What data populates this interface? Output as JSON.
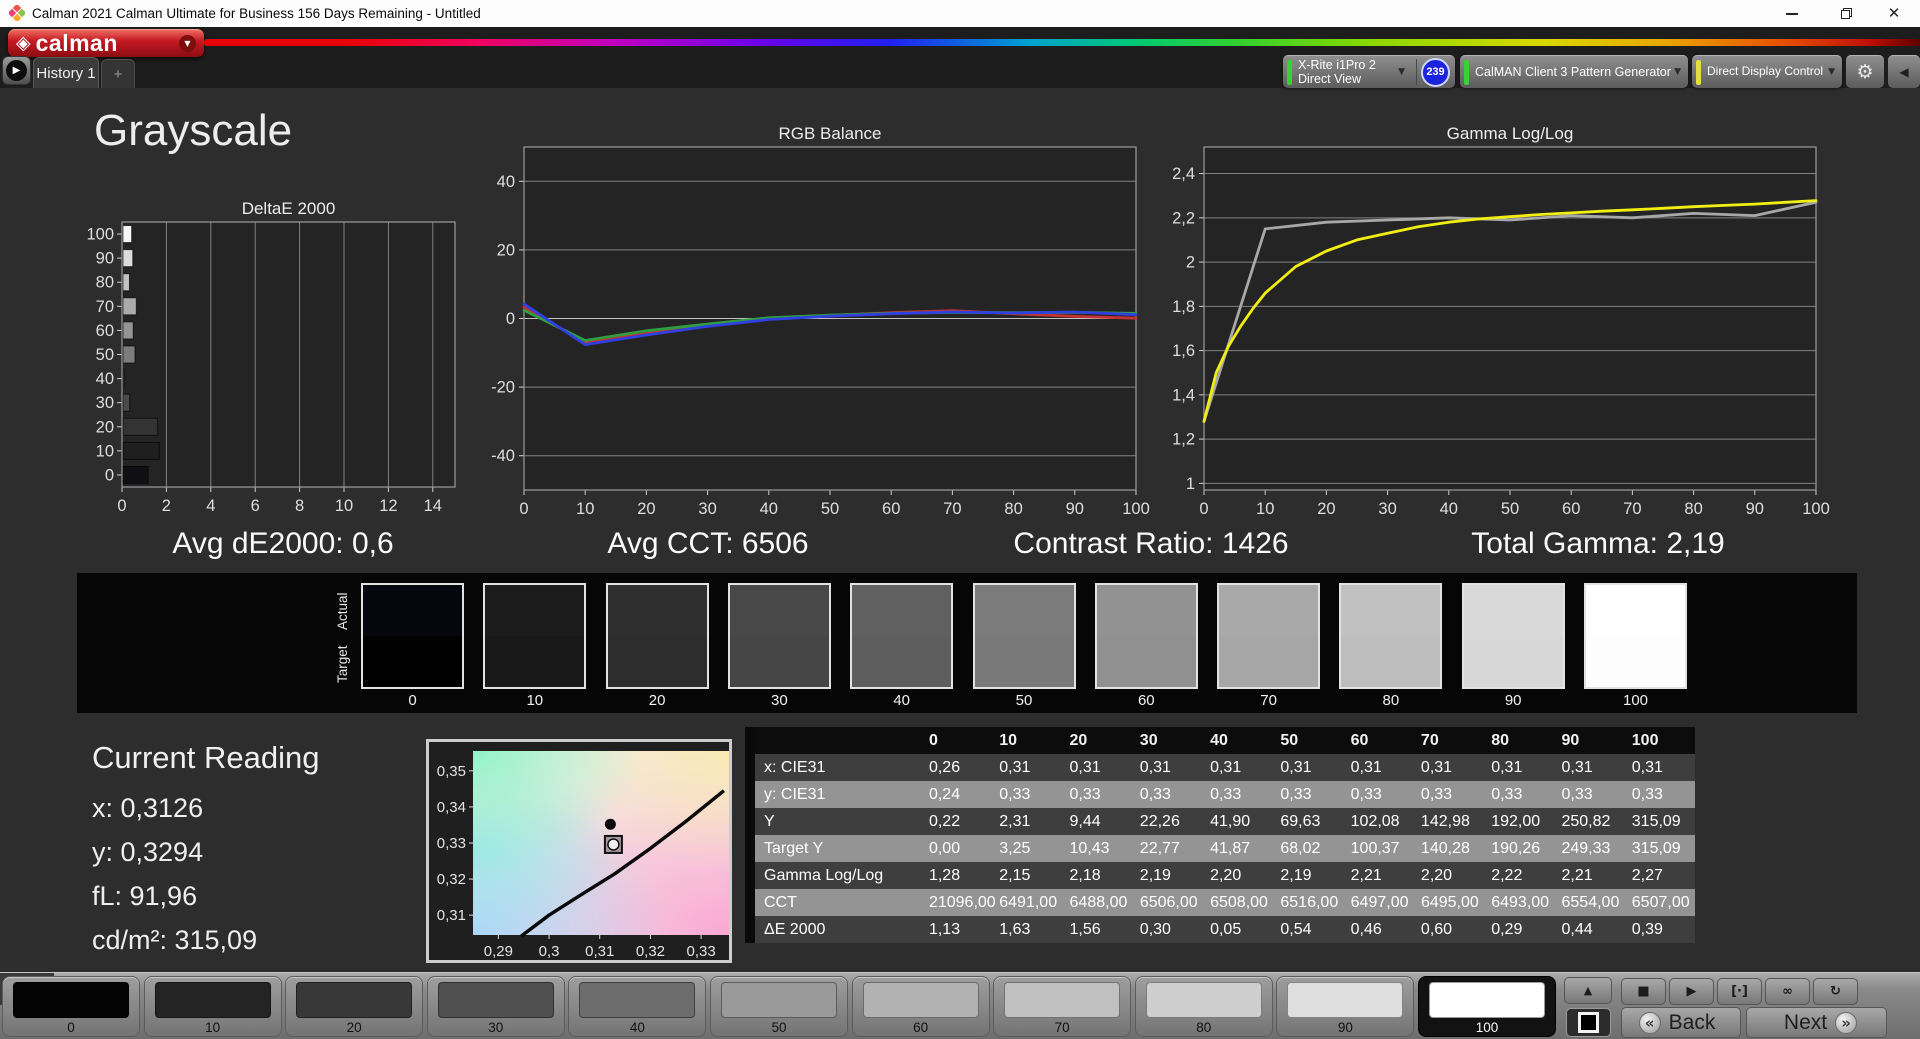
{
  "window": {
    "title": "Calman 2021 Calman Ultimate for Business 156 Days Remaining  - Untitled"
  },
  "brand": {
    "logo_text": "calman",
    "brand_red": "#c41a23"
  },
  "tabs": {
    "history": "History 1",
    "add": "+"
  },
  "toolbar": {
    "meter": {
      "line1": "X-Rite i1Pro 2",
      "line2": "Direct View",
      "accent": "#35d435",
      "badge": "239",
      "badge_color": "#1c23dd"
    },
    "pattern_generator": {
      "label": "CalMAN Client 3 Pattern Generator",
      "accent": "#35d435"
    },
    "display_control": {
      "label": "Direct Display Control",
      "accent": "#e3de3b"
    }
  },
  "page": {
    "title": "Grayscale"
  },
  "stats": [
    "Avg dE2000: 0,6",
    "Avg CCT: 6506",
    "Contrast Ratio: 1426",
    "Total Gamma: 2,19"
  ],
  "chart_data": [
    {
      "id": "deltae",
      "type": "bar",
      "title": "DeltaE 2000",
      "orientation": "horizontal",
      "categories": [
        "0",
        "10",
        "20",
        "30",
        "40",
        "50",
        "60",
        "70",
        "80",
        "90",
        "100"
      ],
      "values": [
        1.13,
        1.63,
        1.56,
        0.3,
        0.05,
        0.54,
        0.46,
        0.6,
        0.29,
        0.44,
        0.39
      ],
      "bar_colors": [
        "#101014",
        "#1f1f1f",
        "#333333",
        "#4b4b4b",
        "#636363",
        "#7d7d7d",
        "#949494",
        "#ababab",
        "#c3c3c3",
        "#dcdcdc",
        "#f8f8f8"
      ],
      "xlim": [
        0,
        15
      ],
      "xticks": [
        0,
        2,
        4,
        6,
        8,
        10,
        12,
        14
      ],
      "note": "categories plotted top-to-bottom from 100 down to 0"
    },
    {
      "id": "rgb-balance",
      "type": "line",
      "title": "RGB Balance",
      "x": [
        0,
        10,
        20,
        30,
        40,
        50,
        60,
        70,
        80,
        90,
        100
      ],
      "series": [
        {
          "name": "Red",
          "color": "#c23232",
          "values": [
            3.2,
            -7.0,
            -4.4,
            -2.0,
            0.0,
            0.9,
            1.7,
            2.3,
            1.4,
            0.6,
            0.1
          ]
        },
        {
          "name": "Green",
          "color": "#2f9e3f",
          "values": [
            2.4,
            -6.4,
            -3.6,
            -1.6,
            0.2,
            1.0,
            1.5,
            1.8,
            1.7,
            1.8,
            1.5
          ]
        },
        {
          "name": "Blue",
          "color": "#2f3fe0",
          "values": [
            4.2,
            -7.6,
            -4.8,
            -2.3,
            -0.3,
            0.7,
            1.4,
            1.9,
            1.6,
            1.9,
            1.1
          ]
        }
      ],
      "xlim": [
        0,
        100
      ],
      "ylim": [
        -50,
        50
      ],
      "yticks": [
        -40,
        -20,
        0,
        20,
        40
      ],
      "ytick_labels": [
        "-40",
        "-20",
        "0",
        "20",
        "40"
      ],
      "xticks": [
        0,
        10,
        20,
        30,
        40,
        50,
        60,
        70,
        80,
        90,
        100
      ]
    },
    {
      "id": "gamma",
      "type": "line",
      "title": "Gamma Log/Log",
      "series": [
        {
          "name": "Measured",
          "color": "#a8a8a8",
          "x": [
            0,
            10,
            20,
            30,
            40,
            50,
            60,
            70,
            80,
            90,
            100
          ],
          "values": [
            1.28,
            2.15,
            2.18,
            2.19,
            2.2,
            2.19,
            2.21,
            2.2,
            2.22,
            2.21,
            2.27
          ]
        },
        {
          "name": "Target",
          "color": "#f2ee12",
          "x": [
            0,
            2,
            4,
            6,
            8,
            10,
            15,
            20,
            25,
            30,
            35,
            40,
            45,
            50,
            55,
            60,
            65,
            70,
            75,
            80,
            85,
            90,
            95,
            100
          ],
          "values": [
            1.28,
            1.5,
            1.62,
            1.71,
            1.79,
            1.86,
            1.98,
            2.05,
            2.1,
            2.13,
            2.16,
            2.18,
            2.195,
            2.205,
            2.215,
            2.222,
            2.23,
            2.236,
            2.243,
            2.25,
            2.256,
            2.262,
            2.27,
            2.278
          ]
        }
      ],
      "xlim": [
        0,
        100
      ],
      "ylim": [
        0.97,
        2.52
      ],
      "yticks": [
        1,
        1.2,
        1.4,
        1.6,
        1.8,
        2,
        2.2,
        2.4
      ],
      "ytick_labels": [
        "1",
        "1,2",
        "1,4",
        "1,6",
        "1,8",
        "2",
        "2,2",
        "2,4"
      ],
      "xticks": [
        0,
        10,
        20,
        30,
        40,
        50,
        60,
        70,
        80,
        90,
        100
      ]
    },
    {
      "id": "cie-shift",
      "type": "scatter",
      "title": "",
      "xlim": [
        0.285,
        0.3355
      ],
      "ylim": [
        0.3045,
        0.3555
      ],
      "xticks": [
        0.29,
        0.3,
        0.31,
        0.32,
        0.33
      ],
      "xtick_labels": [
        "0,29",
        "0,3",
        "0,31",
        "0,32",
        "0,33"
      ],
      "yticks": [
        0.31,
        0.32,
        0.33,
        0.34,
        0.35
      ],
      "ytick_labels": [
        "0,31",
        "0,32",
        "0,33",
        "0,34",
        "0,35"
      ],
      "locus": [
        [
          0.2945,
          0.3042
        ],
        [
          0.3,
          0.31
        ],
        [
          0.3065,
          0.3158
        ],
        [
          0.313,
          0.3215
        ],
        [
          0.32,
          0.3285
        ],
        [
          0.327,
          0.336
        ],
        [
          0.3345,
          0.3445
        ]
      ],
      "points": [
        {
          "name": "measured",
          "x": 0.3121,
          "y": 0.3352
        },
        {
          "name": "target",
          "x": 0.3127,
          "y": 0.3296
        }
      ]
    }
  ],
  "grayscale_ramp": {
    "row_labels": [
      "Actual",
      "Target"
    ],
    "levels": [
      "0",
      "10",
      "20",
      "30",
      "40",
      "50",
      "60",
      "70",
      "80",
      "90",
      "100"
    ],
    "actual_colors": [
      "#06060e",
      "#1c1c1c",
      "#2f2f2f",
      "#484848",
      "#606060",
      "#7b7b7b",
      "#929292",
      "#a9a9a9",
      "#c0c0c0",
      "#d9d9d9",
      "#ffffff"
    ],
    "target_colors": [
      "#000000",
      "#191919",
      "#2d2d2d",
      "#464646",
      "#5e5e5e",
      "#797979",
      "#909090",
      "#a7a7a7",
      "#bebebe",
      "#d7d7d7",
      "#fdfdfd"
    ]
  },
  "current_reading": {
    "title": "Current Reading",
    "lines": [
      "x: 0,3126",
      "y: 0,3294",
      "fL: 91,96",
      "cd/m²: 315,09"
    ]
  },
  "results_table": {
    "columns": [
      "0",
      "10",
      "20",
      "30",
      "40",
      "50",
      "60",
      "70",
      "80",
      "90",
      "100"
    ],
    "rows": [
      {
        "label": "x: CIE31",
        "values": [
          "0,26",
          "0,31",
          "0,31",
          "0,31",
          "0,31",
          "0,31",
          "0,31",
          "0,31",
          "0,31",
          "0,31",
          "0,31"
        ]
      },
      {
        "label": "y: CIE31",
        "values": [
          "0,24",
          "0,33",
          "0,33",
          "0,33",
          "0,33",
          "0,33",
          "0,33",
          "0,33",
          "0,33",
          "0,33",
          "0,33"
        ]
      },
      {
        "label": "Y",
        "values": [
          "0,22",
          "2,31",
          "9,44",
          "22,26",
          "41,90",
          "69,63",
          "102,08",
          "142,98",
          "192,00",
          "250,82",
          "315,09"
        ]
      },
      {
        "label": "Target Y",
        "values": [
          "0,00",
          "3,25",
          "10,43",
          "22,77",
          "41,87",
          "68,02",
          "100,37",
          "140,28",
          "190,26",
          "249,33",
          "315,09"
        ]
      },
      {
        "label": "Gamma Log/Log",
        "values": [
          "1,28",
          "2,15",
          "2,18",
          "2,19",
          "2,20",
          "2,19",
          "2,21",
          "2,20",
          "2,22",
          "2,21",
          "2,27"
        ]
      },
      {
        "label": "CCT",
        "values": [
          "21096,00",
          "6491,00",
          "6488,00",
          "6506,00",
          "6508,00",
          "6516,00",
          "6497,00",
          "6495,00",
          "6493,00",
          "6554,00",
          "6507,00"
        ]
      },
      {
        "label": "ΔE 2000",
        "values": [
          "1,13",
          "1,63",
          "1,56",
          "0,30",
          "0,05",
          "0,54",
          "0,46",
          "0,60",
          "0,29",
          "0,44",
          "0,39"
        ]
      }
    ]
  },
  "pattern_bar": {
    "levels": [
      {
        "label": "0",
        "color": "#030303"
      },
      {
        "label": "10",
        "color": "#242424"
      },
      {
        "label": "20",
        "color": "#383838"
      },
      {
        "label": "30",
        "color": "#505050"
      },
      {
        "label": "40",
        "color": "#6c6c6c"
      },
      {
        "label": "50",
        "color": "#9a9a9a"
      },
      {
        "label": "60",
        "color": "#b2b2b2"
      },
      {
        "label": "70",
        "color": "#c0c0c0"
      },
      {
        "label": "80",
        "color": "#cecece"
      },
      {
        "label": "90",
        "color": "#dedede"
      },
      {
        "label": "100",
        "color": "#ffffff"
      }
    ],
    "selected": "100",
    "transport": [
      {
        "name": "stop",
        "glyph": "■"
      },
      {
        "name": "play",
        "glyph": "▶"
      },
      {
        "name": "measure-options",
        "glyph": "[·]"
      },
      {
        "name": "continuous",
        "glyph": "∞"
      },
      {
        "name": "refresh",
        "glyph": "↻"
      }
    ],
    "back_label": "Back",
    "next_label": "Next"
  }
}
